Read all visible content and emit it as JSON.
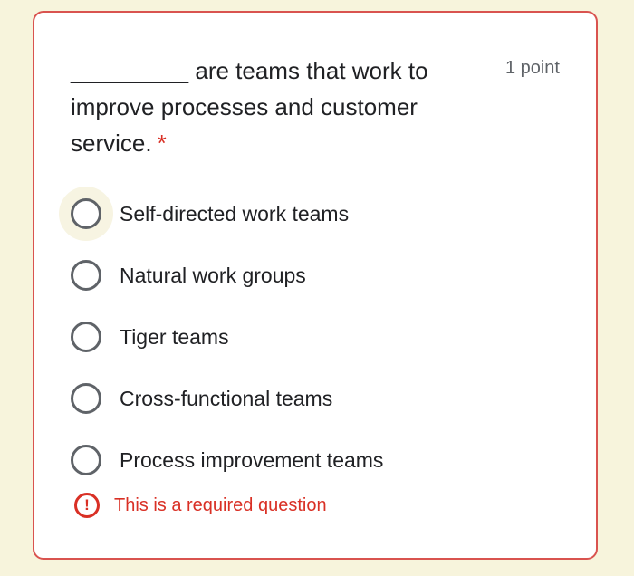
{
  "question": {
    "text": "_________ are teams that work to improve processes and customer service.",
    "required_marker": "*",
    "points": "1 point"
  },
  "options": [
    {
      "label": "Self-directed work teams",
      "selected": false,
      "focused": true
    },
    {
      "label": "Natural work groups",
      "selected": false,
      "focused": false
    },
    {
      "label": "Tiger teams",
      "selected": false,
      "focused": false
    },
    {
      "label": "Cross-functional teams",
      "selected": false,
      "focused": false
    },
    {
      "label": "Process improvement teams",
      "selected": false,
      "focused": false
    }
  ],
  "error": {
    "icon": "exclamation-circle-icon",
    "text": "This is a required question"
  },
  "colors": {
    "background": "#f7f4dc",
    "card_border": "#d9534f",
    "error": "#d93025",
    "text": "#202124",
    "muted": "#5f6368"
  }
}
